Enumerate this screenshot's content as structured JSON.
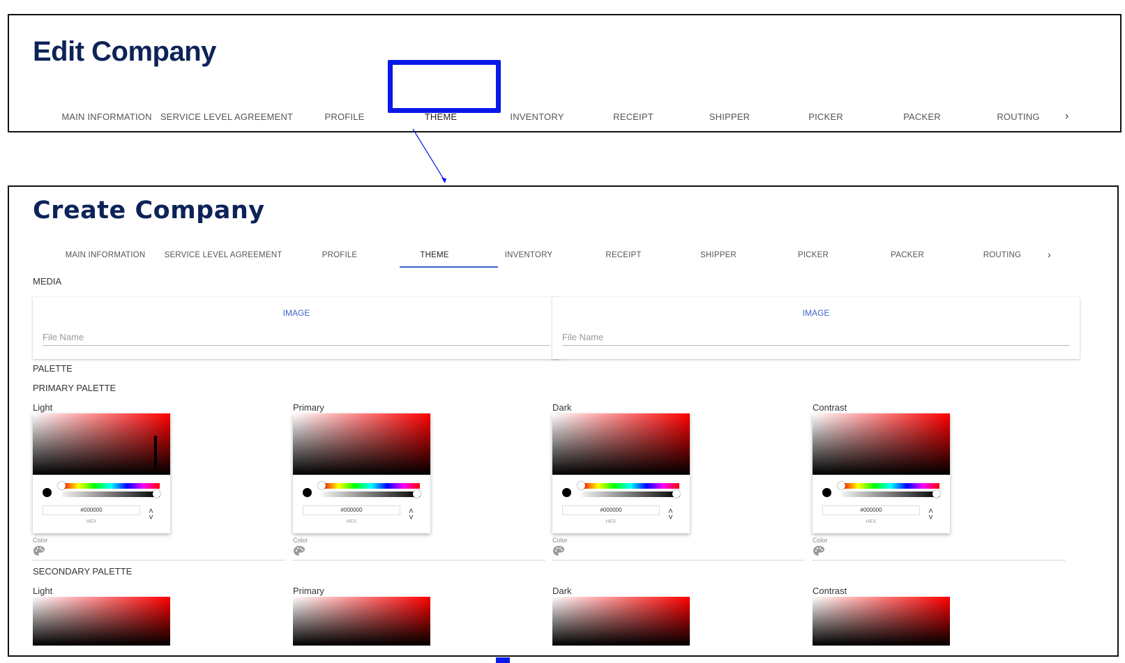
{
  "edit_panel": {
    "title": "Edit Company",
    "tabs": [
      "MAIN INFORMATION",
      "SERVICE LEVEL AGREEMENT",
      "PROFILE",
      "THEME",
      "INVENTORY",
      "RECEIPT",
      "SHIPPER",
      "PICKER",
      "PACKER",
      "ROUTING"
    ],
    "active_tab": "THEME",
    "more_icon": "chevron-right-icon"
  },
  "create_panel": {
    "title": "Create Company",
    "tabs": [
      "MAIN INFORMATION",
      "SERVICE LEVEL AGREEMENT",
      "PROFILE",
      "THEME",
      "INVENTORY",
      "RECEIPT",
      "SHIPPER",
      "PICKER",
      "PACKER",
      "ROUTING"
    ],
    "active_tab": "THEME",
    "media": {
      "label": "MEDIA",
      "cards": [
        {
          "button": "IMAGE",
          "placeholder": "File Name"
        },
        {
          "button": "IMAGE",
          "placeholder": "File Name"
        }
      ]
    },
    "palette": {
      "label": "PALETTE",
      "primary": {
        "label": "PRIMARY PALETTE",
        "swatches": [
          {
            "label": "Light",
            "hex": "#000000",
            "hex_label": "HEX",
            "field_caption": "Color"
          },
          {
            "label": "Primary",
            "hex": "#000000",
            "hex_label": "HEX",
            "field_caption": "Color"
          },
          {
            "label": "Dark",
            "hex": "#000000",
            "hex_label": "HEX",
            "field_caption": "Color"
          },
          {
            "label": "Contrast",
            "hex": "#000000",
            "hex_label": "HEX",
            "field_caption": "Color"
          }
        ]
      },
      "secondary": {
        "label": "SECONDARY PALETTE",
        "swatches": [
          {
            "label": "Light"
          },
          {
            "label": "Primary"
          },
          {
            "label": "Dark"
          },
          {
            "label": "Contrast"
          }
        ]
      }
    }
  },
  "colors": {
    "title": "#0d2358",
    "highlight": "#0a18e8",
    "accent": "#3b63c8",
    "picker_hue": "#ff0000"
  }
}
